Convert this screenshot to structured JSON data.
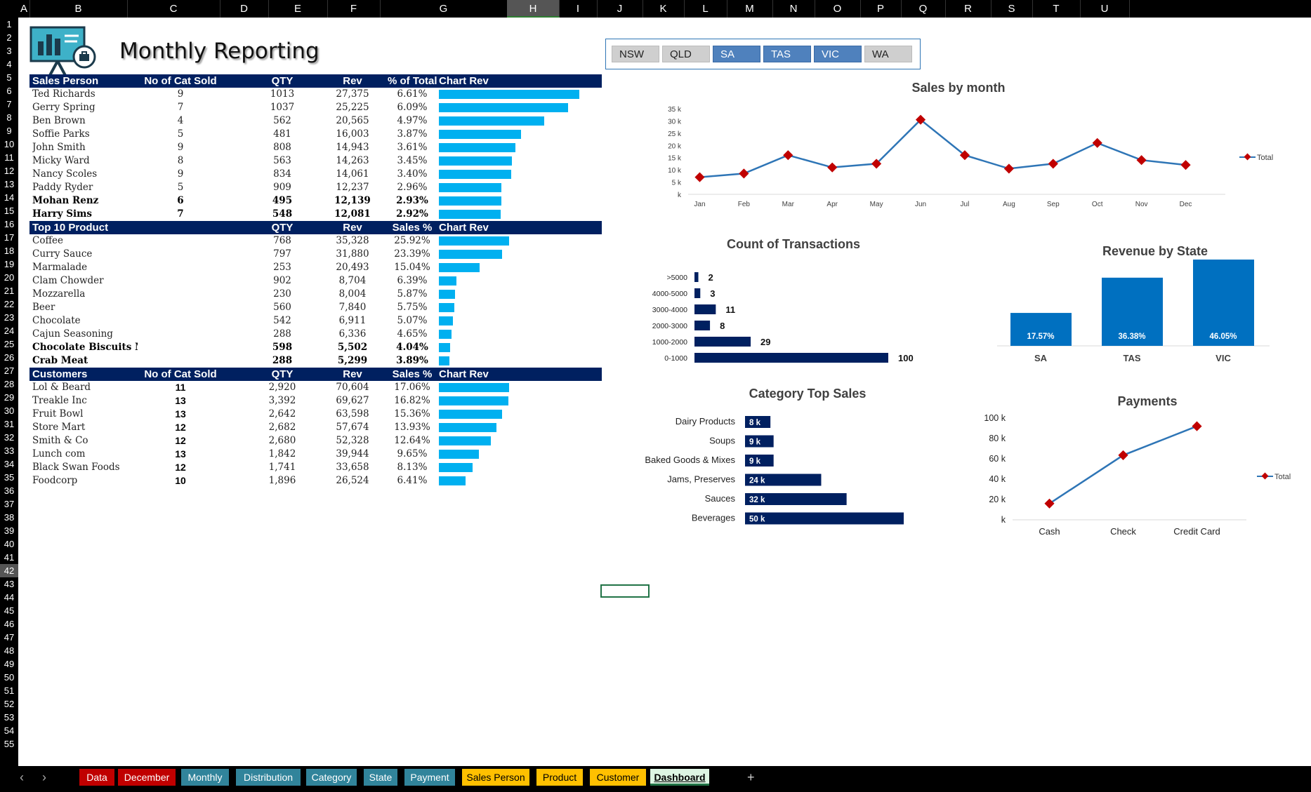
{
  "columns": [
    "A",
    "B",
    "C",
    "D",
    "E",
    "F",
    "G",
    "H",
    "I",
    "J",
    "K",
    "L",
    "M",
    "N",
    "O",
    "P",
    "Q",
    "R",
    "S",
    "T",
    "U"
  ],
  "selected_column": "H",
  "selected_row": "42",
  "rows": [
    "1",
    "2",
    "3",
    "4",
    "5",
    "6",
    "7",
    "8",
    "9",
    "10",
    "11",
    "12",
    "13",
    "14",
    "15",
    "16",
    "17",
    "18",
    "19",
    "20",
    "21",
    "22",
    "23",
    "24",
    "25",
    "26",
    "27",
    "28",
    "29",
    "30",
    "31",
    "32",
    "33",
    "34",
    "35",
    "36",
    "37",
    "38",
    "39",
    "40",
    "41",
    "42",
    "43",
    "44",
    "45",
    "46",
    "47",
    "48",
    "49",
    "50",
    "51",
    "52",
    "53",
    "54",
    "55"
  ],
  "title": "Monthly Reporting",
  "slicer": {
    "items": [
      {
        "label": "NSW",
        "selected": false
      },
      {
        "label": "QLD",
        "selected": false
      },
      {
        "label": "SA",
        "selected": true
      },
      {
        "label": "TAS",
        "selected": true
      },
      {
        "label": "VIC",
        "selected": true
      },
      {
        "label": "WA",
        "selected": false
      }
    ]
  },
  "sales_table": {
    "headers": [
      "Sales Person",
      "No of Cat Sold",
      "QTY",
      "Rev",
      "% of Total",
      "Chart Rev"
    ],
    "rows": [
      {
        "name": "Ted Richards",
        "cat": "9",
        "qty": "1013",
        "rev": "27,375",
        "pct": "6.61%",
        "val": 27375,
        "bold": false
      },
      {
        "name": "Gerry Spring",
        "cat": "7",
        "qty": "1037",
        "rev": "25,225",
        "pct": "6.09%",
        "val": 25225,
        "bold": false
      },
      {
        "name": "Ben Brown",
        "cat": "4",
        "qty": "562",
        "rev": "20,565",
        "pct": "4.97%",
        "val": 20565,
        "bold": false
      },
      {
        "name": "Soffie Parks",
        "cat": "5",
        "qty": "481",
        "rev": "16,003",
        "pct": "3.87%",
        "val": 16003,
        "bold": false
      },
      {
        "name": "John Smith",
        "cat": "9",
        "qty": "808",
        "rev": "14,943",
        "pct": "3.61%",
        "val": 14943,
        "bold": false
      },
      {
        "name": "Micky Ward",
        "cat": "8",
        "qty": "563",
        "rev": "14,263",
        "pct": "3.45%",
        "val": 14263,
        "bold": false
      },
      {
        "name": "Nancy Scoles",
        "cat": "9",
        "qty": "834",
        "rev": "14,061",
        "pct": "3.40%",
        "val": 14061,
        "bold": false
      },
      {
        "name": "Paddy Ryder",
        "cat": "5",
        "qty": "909",
        "rev": "12,237",
        "pct": "2.96%",
        "val": 12237,
        "bold": false
      },
      {
        "name": "Mohan Renz",
        "cat": "6",
        "qty": "495",
        "rev": "12,139",
        "pct": "2.93%",
        "val": 12139,
        "bold": true
      },
      {
        "name": "Harry Sims",
        "cat": "7",
        "qty": "548",
        "rev": "12,081",
        "pct": "2.92%",
        "val": 12081,
        "bold": true
      }
    ]
  },
  "product_table": {
    "headers": [
      "Top 10 Product",
      "",
      "QTY",
      "Rev",
      "Sales %",
      "Chart Rev"
    ],
    "rows": [
      {
        "name": "Coffee",
        "cat": "",
        "qty": "768",
        "rev": "35,328",
        "pct": "25.92%",
        "val": 35328,
        "bold": false
      },
      {
        "name": "Curry Sauce",
        "cat": "",
        "qty": "797",
        "rev": "31,880",
        "pct": "23.39%",
        "val": 31880,
        "bold": false
      },
      {
        "name": "Marmalade",
        "cat": "",
        "qty": "253",
        "rev": "20,493",
        "pct": "15.04%",
        "val": 20493,
        "bold": false
      },
      {
        "name": "Clam Chowder",
        "cat": "",
        "qty": "902",
        "rev": "8,704",
        "pct": "6.39%",
        "val": 8704,
        "bold": false
      },
      {
        "name": "Mozzarella",
        "cat": "",
        "qty": "230",
        "rev": "8,004",
        "pct": "5.87%",
        "val": 8004,
        "bold": false
      },
      {
        "name": "Beer",
        "cat": "",
        "qty": "560",
        "rev": "7,840",
        "pct": "5.75%",
        "val": 7840,
        "bold": false
      },
      {
        "name": "Chocolate",
        "cat": "",
        "qty": "542",
        "rev": "6,911",
        "pct": "5.07%",
        "val": 6911,
        "bold": false
      },
      {
        "name": "Cajun Seasoning",
        "cat": "",
        "qty": "288",
        "rev": "6,336",
        "pct": "4.65%",
        "val": 6336,
        "bold": false
      },
      {
        "name": "Chocolate Biscuits Mix",
        "cat": "",
        "qty": "598",
        "rev": "5,502",
        "pct": "4.04%",
        "val": 5502,
        "bold": true
      },
      {
        "name": "Crab Meat",
        "cat": "",
        "qty": "288",
        "rev": "5,299",
        "pct": "3.89%",
        "val": 5299,
        "bold": true
      }
    ]
  },
  "customer_table": {
    "headers": [
      "Customers",
      "No of Cat Sold",
      "QTY",
      "Rev",
      "Sales %",
      "Chart Rev"
    ],
    "rows": [
      {
        "name": "Lol & Beard",
        "cat": "11",
        "qty": "2,920",
        "rev": "70,604",
        "pct": "17.06%",
        "val": 70604,
        "bold": false
      },
      {
        "name": "Treakle Inc",
        "cat": "13",
        "qty": "3,392",
        "rev": "69,627",
        "pct": "16.82%",
        "val": 69627,
        "bold": false
      },
      {
        "name": "Fruit Bowl",
        "cat": "13",
        "qty": "2,642",
        "rev": "63,598",
        "pct": "15.36%",
        "val": 63598,
        "bold": false
      },
      {
        "name": "Store Mart",
        "cat": "12",
        "qty": "2,682",
        "rev": "57,674",
        "pct": "13.93%",
        "val": 57674,
        "bold": false
      },
      {
        "name": "Smith & Co",
        "cat": "12",
        "qty": "2,680",
        "rev": "52,328",
        "pct": "12.64%",
        "val": 52328,
        "bold": false
      },
      {
        "name": "Lunch com",
        "cat": "13",
        "qty": "1,842",
        "rev": "39,944",
        "pct": "9.65%",
        "val": 39944,
        "bold": false
      },
      {
        "name": "Black Swan Foods",
        "cat": "12",
        "qty": "1,741",
        "rev": "33,658",
        "pct": "8.13%",
        "val": 33658,
        "bold": false
      },
      {
        "name": "Foodcorp",
        "cat": "10",
        "qty": "1,896",
        "rev": "26,524",
        "pct": "6.41%",
        "val": 26524,
        "bold": false
      }
    ]
  },
  "chart_data": [
    {
      "id": "sales-by-month",
      "type": "line",
      "title": "Sales by month",
      "categories": [
        "Jan",
        "Feb",
        "Mar",
        "Apr",
        "May",
        "Jun",
        "Jul",
        "Aug",
        "Sep",
        "Oct",
        "Nov",
        "Dec"
      ],
      "series": [
        {
          "name": "Total",
          "values": [
            7000,
            8500,
            16000,
            11000,
            12500,
            30500,
            16000,
            10500,
            12500,
            21000,
            14000,
            12000
          ]
        }
      ],
      "yticks": [
        "k",
        "5 k",
        "10 k",
        "15 k",
        "20 k",
        "25 k",
        "30 k",
        "35 k"
      ],
      "ylim": [
        0,
        35000
      ],
      "legend": "right",
      "color": "#2e75b6",
      "marker_color": "#c00000"
    },
    {
      "id": "count-of-transactions",
      "type": "bar",
      "title": "Count of Transactions",
      "categories": [
        ">5000",
        "4000-5000",
        "3000-4000",
        "2000-3000",
        "1000-2000",
        "0-1000"
      ],
      "values": [
        2,
        3,
        11,
        8,
        29,
        100
      ],
      "color": "#002060"
    },
    {
      "id": "revenue-by-state",
      "type": "bar",
      "title": "Revenue by State",
      "categories": [
        "SA",
        "TAS",
        "VIC"
      ],
      "values": [
        17.57,
        36.38,
        46.05
      ],
      "labels": [
        "17.57%",
        "36.38%",
        "46.05%"
      ],
      "color": "#0070c0"
    },
    {
      "id": "category-top-sales",
      "type": "bar",
      "title": "Category Top Sales",
      "categories": [
        "Dairy Products",
        "Soups",
        "Baked Goods & Mixes",
        "Jams, Preserves",
        "Sauces",
        "Beverages"
      ],
      "values": [
        8,
        9,
        9,
        24,
        32,
        50
      ],
      "labels": [
        "8 k",
        "9 k",
        "9 k",
        "24 k",
        "32 k",
        "50 k"
      ],
      "color": "#002060"
    },
    {
      "id": "payments",
      "type": "line",
      "title": "Payments",
      "categories": [
        "Cash",
        "Check",
        "Credit Card"
      ],
      "series": [
        {
          "name": "Total",
          "values": [
            16000,
            63500,
            92000
          ]
        }
      ],
      "yticks": [
        "k",
        "20 k",
        "40 k",
        "60 k",
        "80 k",
        "100 k"
      ],
      "ylim": [
        0,
        100000
      ],
      "legend": "right",
      "color": "#2e75b6",
      "marker_color": "#c00000"
    }
  ],
  "sheet_tabs": [
    {
      "label": "Data",
      "bg": "#c00000",
      "fg": "#ffffff"
    },
    {
      "label": "December",
      "bg": "#c00000",
      "fg": "#ffffff"
    },
    {
      "label": "Monthly",
      "bg": "#31849b",
      "fg": "#ffffff"
    },
    {
      "label": "Distribution",
      "bg": "#31849b",
      "fg": "#ffffff"
    },
    {
      "label": "Category",
      "bg": "#31849b",
      "fg": "#ffffff"
    },
    {
      "label": "State",
      "bg": "#31849b",
      "fg": "#ffffff"
    },
    {
      "label": "Payment",
      "bg": "#31849b",
      "fg": "#ffffff"
    },
    {
      "label": "Sales Person",
      "bg": "#ffc000",
      "fg": "#000000"
    },
    {
      "label": "Product",
      "bg": "#ffc000",
      "fg": "#000000"
    },
    {
      "label": "Customer",
      "bg": "#ffc000",
      "fg": "#000000"
    },
    {
      "label": "Dashboard",
      "bg": "#ddf5e3",
      "fg": "#000000",
      "active": true
    }
  ],
  "add_sheet_label": "+",
  "nav_prev_label": "‹",
  "nav_next_label": "›"
}
